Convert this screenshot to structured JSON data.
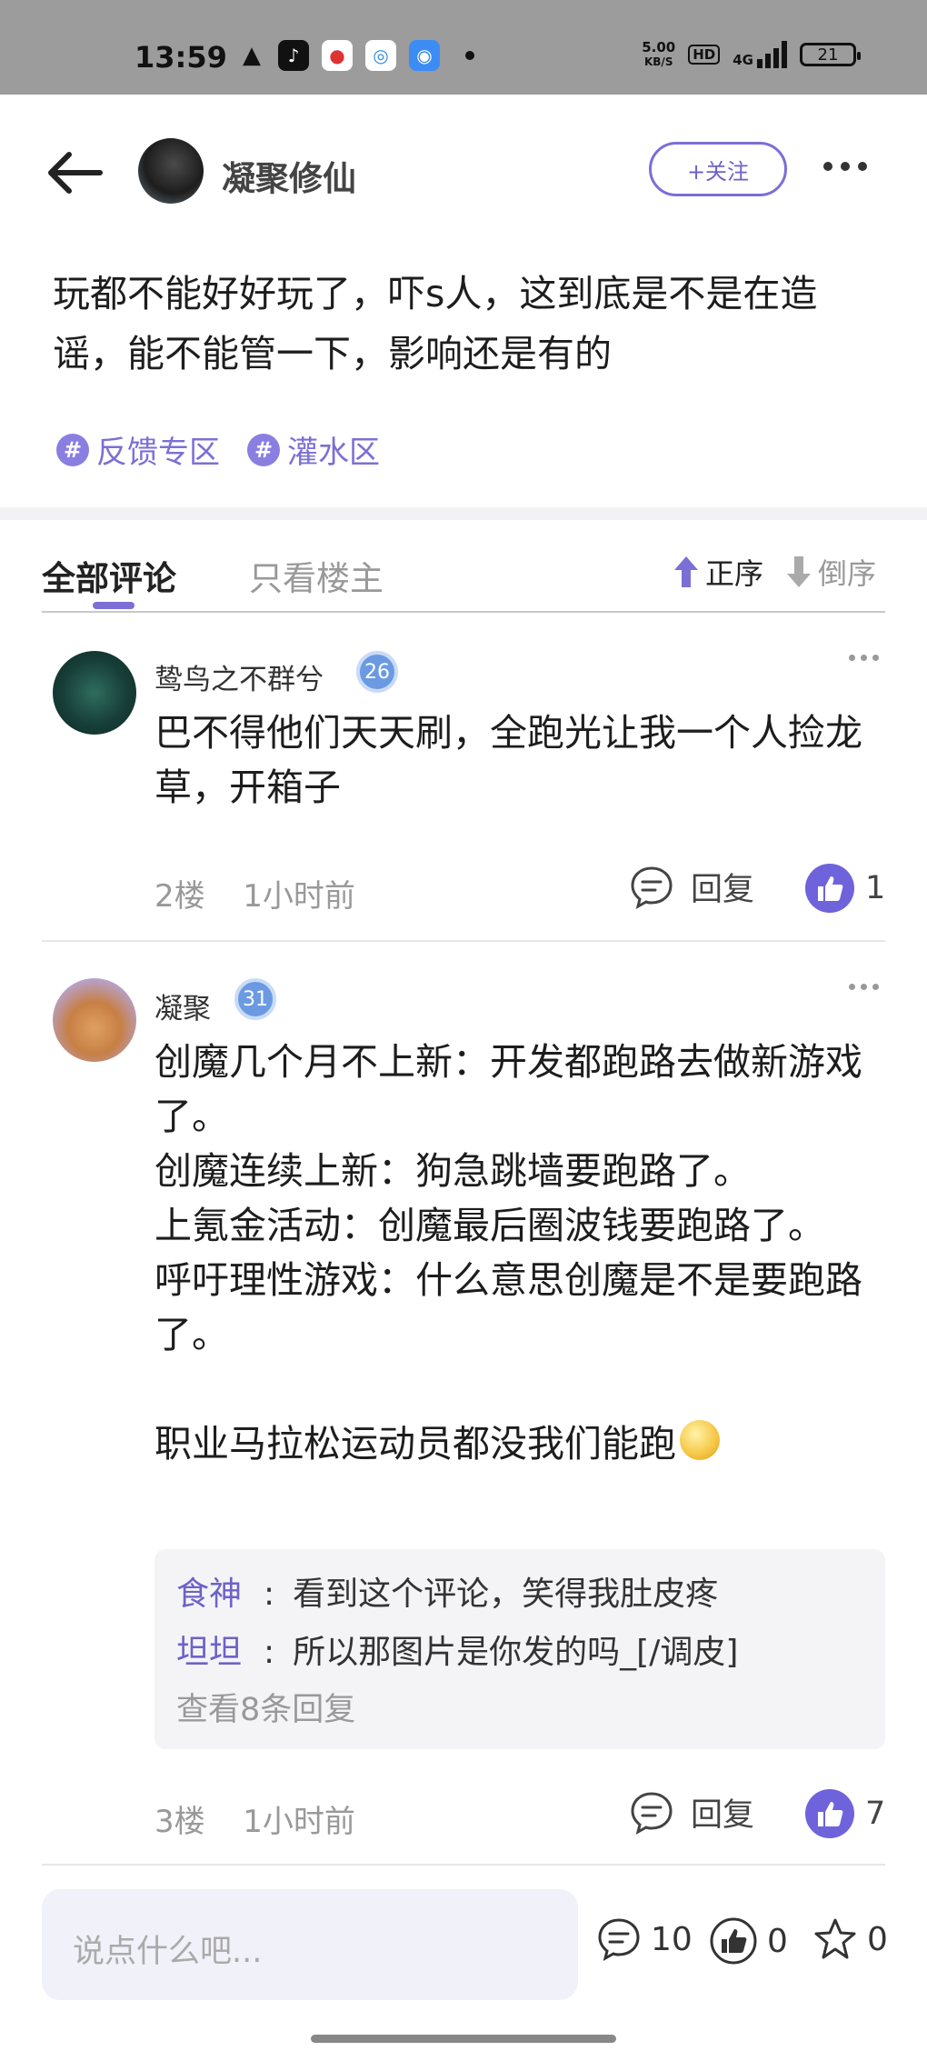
{
  "status_bar": {
    "time": "13:59",
    "net_speed_value": "5.00",
    "net_speed_unit": "KB/S",
    "hd": "HD",
    "network": "4G",
    "battery": "21"
  },
  "header": {
    "title": "凝聚修仙",
    "follow_label": "+关注"
  },
  "post": {
    "text": "玩都不能好好玩了，吓s人，这到底是不是在造谣，能不能管一下，影响还是有的",
    "tags": [
      "反馈专区",
      "灌水区"
    ]
  },
  "tabs": {
    "all": "全部评论",
    "owner_only": "只看楼主",
    "sort_asc": "正序",
    "sort_desc": "倒序"
  },
  "comments": [
    {
      "author": "鸷鸟之不群兮",
      "level": "26",
      "text": "巴不得他们天天刷，全跑光让我一个人捡龙草，开箱子",
      "floor": "2楼",
      "time": "1小时前",
      "reply_label": "回复",
      "likes": "1"
    },
    {
      "author": "凝聚",
      "level": "31",
      "text": "创魔几个月不上新：开发都跑路去做新游戏了。\n创魔连续上新：狗急跳墙要跑路了。\n上氪金活动：创魔最后圈波钱要跑路了。\n呼吁理性游戏：什么意思创魔是不是要跑路了。\n\n职业马拉松运动员都没我们能跑",
      "replies": [
        {
          "name": "食神",
          "text": "看到这个评论，笑得我肚皮疼"
        },
        {
          "name": "坦坦",
          "text": "所以那图片是你发的吗_[/调皮]"
        }
      ],
      "view_more": "查看8条回复",
      "floor": "3楼",
      "time": "1小时前",
      "reply_label": "回复",
      "likes": "7"
    }
  ],
  "bottom_bar": {
    "placeholder": "说点什么吧...",
    "comment_count": "10",
    "like_count": "0",
    "star_count": "0"
  },
  "colors": {
    "accent": "#7b6fd6",
    "status_bar_bg": "#9c9c9c"
  }
}
